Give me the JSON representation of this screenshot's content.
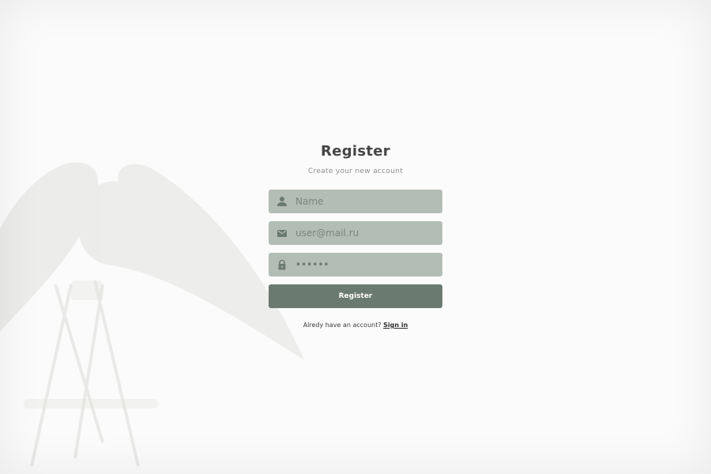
{
  "page": {
    "title": "Register",
    "subtitle": "Create your new account"
  },
  "form": {
    "name_placeholder": "Name",
    "email_placeholder": "user@mail.ru",
    "password_value": "••••••",
    "submit_label": "Register"
  },
  "footer": {
    "prompt": "Alredy have an account?",
    "signin_label": "Sign in"
  },
  "icons": {
    "name": "person-icon",
    "email": "mail-icon",
    "password": "lock-icon"
  },
  "colors": {
    "background": "#fbfbfb",
    "field": "#b4bcb6",
    "button": "#6b7a70",
    "icon": "#6b7a70",
    "title": "#454545"
  }
}
